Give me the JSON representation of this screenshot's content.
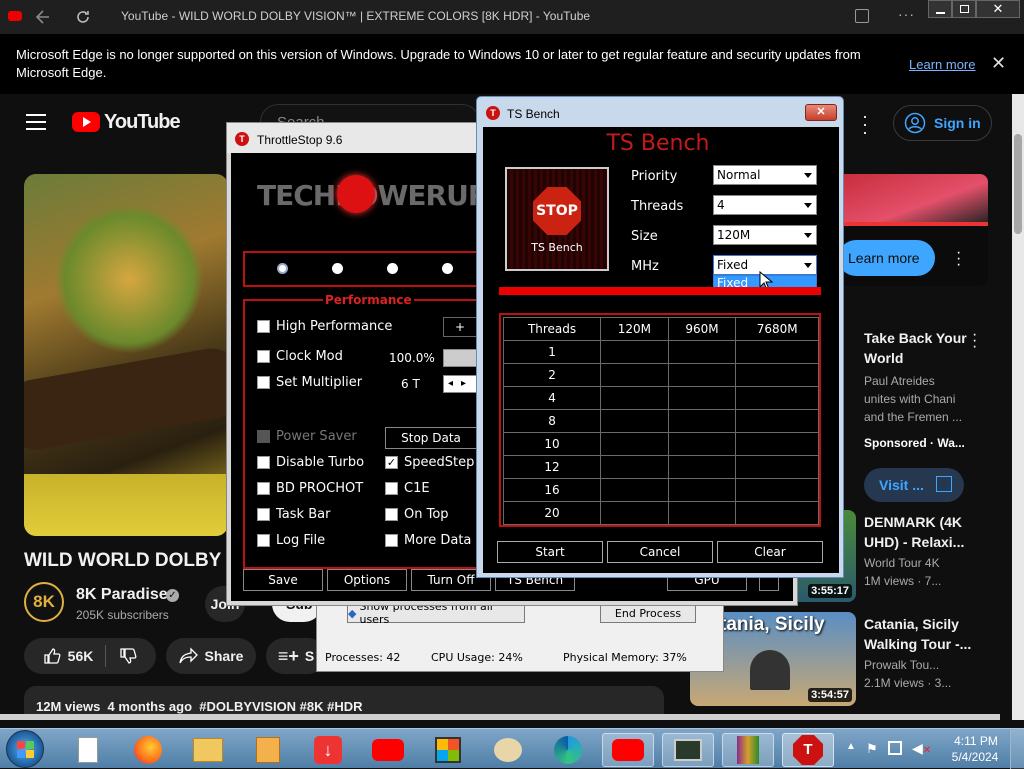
{
  "browser": {
    "tab_title": "YouTube - WILD WORLD DOLBY VISION™ | EXTREME COLORS [8K HDR] - YouTube",
    "infobar_text": "Microsoft Edge is no longer supported on this version of Windows. Upgrade to Windows 10 or later to get regular feature and security updates from Microsoft Edge.",
    "infobar_link": "Learn more"
  },
  "youtube": {
    "logo_text": "YouTube",
    "search_placeholder": "Search",
    "sign_in": "Sign in",
    "video_title": "WILD WORLD DOLBY V",
    "channel_name": "8K Paradise",
    "channel_avatar": "8K",
    "subscribers": "205K subscribers",
    "join": "Join",
    "subscribe": "Sub",
    "likes": "56K",
    "share": "Share",
    "save": "S",
    "views_line": "12M views  4 months ago  #DOLBYVISION #8K #HDR",
    "ad_learn_more": "Learn more",
    "sidebar": [
      {
        "title": "Take Back Your World",
        "line1": "Paul Atreides",
        "line2": "unites with Chani",
        "line3": "and the Fremen ...",
        "line4": "Sponsored · Wa...",
        "button": "Visit ..."
      },
      {
        "title": "DENMARK (4K UHD) - Relaxi...",
        "line1": "World Tour 4K",
        "line2": "1M views · 7...",
        "duration": "3:55:17"
      },
      {
        "title": "Catania, Sicily Walking Tour -...",
        "line1": "Prowalk Tou...",
        "line2": "2.1M views · 3...",
        "duration": "3:54:57",
        "thumb_text": "tania, Sicily"
      }
    ]
  },
  "throttlestop": {
    "title": "ThrottleStop 9.6",
    "logo": "TECHPOWERUP",
    "section": "Performance",
    "high_performance": "High Performance",
    "clock_mod": "Clock Mod",
    "clock_mod_value": "100.0%",
    "set_multiplier": "Set Multiplier",
    "multiplier_value": "6 T",
    "power_saver": "Power Saver",
    "stop_data": "Stop Data",
    "disable_turbo": "Disable Turbo",
    "speedstep": "SpeedStep",
    "bd_prochot": "BD PROCHOT",
    "c1e": "C1E",
    "task_bar": "Task Bar",
    "on_top": "On Top",
    "log_file": "Log File",
    "more_data": "More Data",
    "plus": "+",
    "btn_save": "Save",
    "btn_options": "Options",
    "btn_turnoff": "Turn Off",
    "btn_tsbench": "TS Bench",
    "btn_gpu": "GPU"
  },
  "taskmgr": {
    "show_processes": "Show processes from all users",
    "end_process": "End Process",
    "processes": "Processes: 42",
    "cpu_usage": "CPU Usage: 24%",
    "physical_memory": "Physical Memory: 37%"
  },
  "tsbench": {
    "title": "TS Bench",
    "heading": "TS Bench",
    "stop_label": "STOP",
    "image_caption": "TS Bench",
    "priority_label": "Priority",
    "priority_value": "Normal",
    "threads_label": "Threads",
    "threads_value": "4",
    "size_label": "Size",
    "size_value": "120M",
    "mhz_label": "MHz",
    "mhz_value": "Fixed",
    "mhz_option": "Fixed",
    "table_headers": [
      "Threads",
      "120M",
      "960M",
      "7680M"
    ],
    "table_rows": [
      "1",
      "2",
      "4",
      "8",
      "10",
      "12",
      "16",
      "20"
    ],
    "btn_start": "Start",
    "btn_cancel": "Cancel",
    "btn_clear": "Clear"
  },
  "taskbar": {
    "time": "4:11 PM",
    "date": "5/4/2024"
  }
}
